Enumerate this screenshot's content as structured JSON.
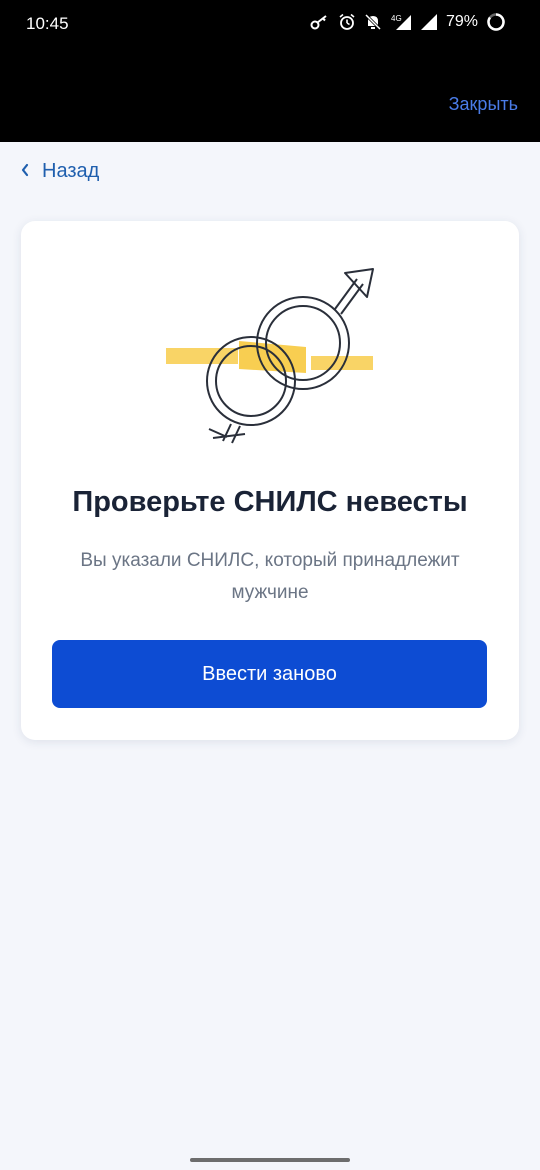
{
  "status_bar": {
    "time": "10:45",
    "network_label": "4G",
    "battery_percent": "79%",
    "icons": [
      "key-icon",
      "alarm-icon",
      "bell-off-icon",
      "mobile-data-icon",
      "signal-icon",
      "battery-icon"
    ]
  },
  "header": {
    "close_label": "Закрыть"
  },
  "nav": {
    "back_label": "Назад"
  },
  "card": {
    "illustration": "gender-symbols-rings-icon",
    "title": "Проверьте СНИЛС невесты",
    "description": "Вы указали СНИЛС, который принадлежит мужчине",
    "button_label": "Ввести заново"
  },
  "colors": {
    "primary": "#0d4cd3",
    "link": "#1f5fae",
    "close_link": "#4a7ce8",
    "accent_yellow": "#f7c533",
    "background": "#f4f6fb"
  }
}
